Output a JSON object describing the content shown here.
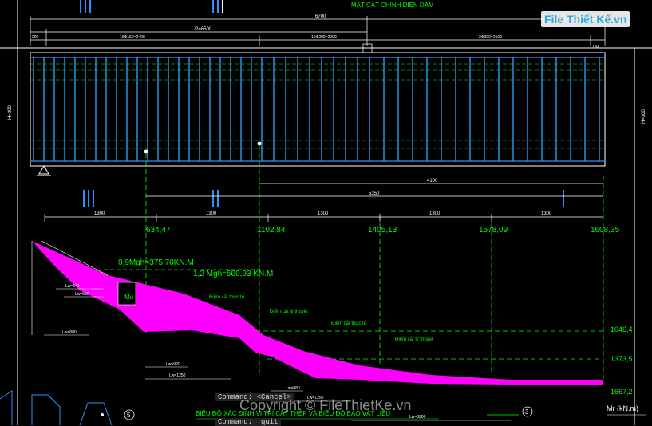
{
  "title_top": "MẶT CẮT CHÍNH DIỆN DẦM",
  "title_bottom": "BIỂU ĐỒ BAO VẬT LIỆU",
  "title_bottom_full": "BIỂU ĐỒ XÁC ĐỊNH VỊ TRÍ CẮT THÉP VÀ BIỂU ĐỒ BAO VẬT LIỆU",
  "section_marks": [
    "III",
    "II",
    "III",
    "II",
    "I"
  ],
  "dims_top": {
    "overall": "6700",
    "half_span": "L/2=6500",
    "left_end": "200",
    "seg1": "16Ф150=2400",
    "seg2": "10Ф200=2000",
    "seg3": "2Ф300=2100",
    "right_end": "150",
    "height": "H=300"
  },
  "dims_mid": {
    "d4100": "4100",
    "d5350": "5350",
    "spans": [
      "1300",
      "1300",
      "1300",
      "1300",
      "1300"
    ]
  },
  "moment_labels": [
    "634,47",
    "1102,84",
    "1405,13",
    "1578,09",
    "1608,35"
  ],
  "right_values": [
    "1046,4",
    "1373,5",
    "1667,2"
  ],
  "formulas": {
    "f1": "0,9Mgh=375,70KN.M",
    "f2": "1,2 Mgh=500,93 KN.M"
  },
  "cut_points": [
    "Điểm cắt thực tế",
    "Điểm cắt lý thuyết",
    "Điểm cắt thực tế",
    "Điểm cắt lý thuyết"
  ],
  "small_labels": [
    "Lw=641",
    "Lw=550",
    "Lw=880",
    "Lw=920",
    "Lw=1250",
    "Lw=880",
    "Lw=1250",
    "Lw=8200"
  ],
  "m_symbol": "Mu",
  "unit_axis": "Mr (kN.m)",
  "circle_marks": [
    "5",
    "3"
  ],
  "commands": [
    "Command: <Cancel>",
    "Command: _quit"
  ],
  "watermark": "Copyright © FileThietKe.vn",
  "logo": "File Thiết Kế.vn",
  "colors": {
    "background": "#000000",
    "stirrup": "#00aaff",
    "dim_green": "#00ff00",
    "diagram": "#ff00ff",
    "text": "#ffffff"
  }
}
